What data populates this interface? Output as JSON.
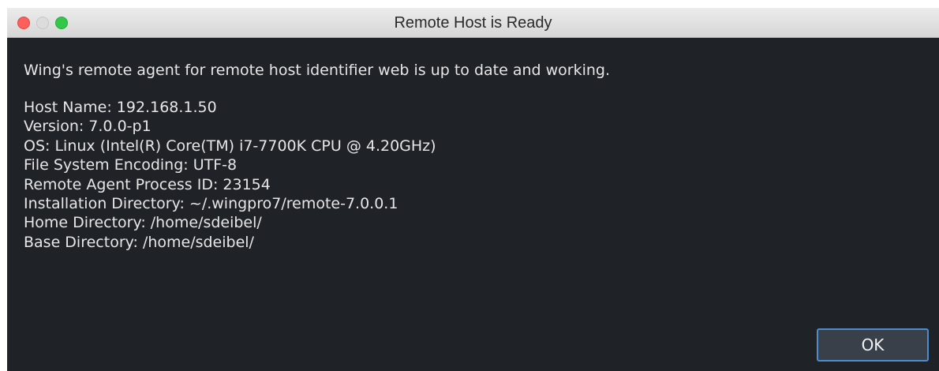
{
  "window": {
    "title": "Remote Host is Ready",
    "controls": [
      "close",
      "minimize",
      "zoom"
    ]
  },
  "dialog": {
    "intro": "Wing's remote agent for remote host identifier web is up to date and working.",
    "info_lines": [
      "Host Name: 192.168.1.50",
      "Version: 7.0.0-p1",
      "OS: Linux (Intel(R) Core(TM) i7-7700K CPU @ 4.20GHz)",
      "File System Encoding: UTF-8",
      "Remote Agent Process ID: 23154",
      "Installation Directory: ~/.wingpro7/remote-7.0.0.1",
      "Home Directory: /home/sdeibel/",
      "Base Directory: /home/sdeibel/"
    ],
    "ok_label": "OK"
  },
  "colors": {
    "background": "#1f2328",
    "text": "#e6e6e6",
    "button_border": "#4d8dcf",
    "close": "#fc605c",
    "zoom": "#34c84a"
  }
}
